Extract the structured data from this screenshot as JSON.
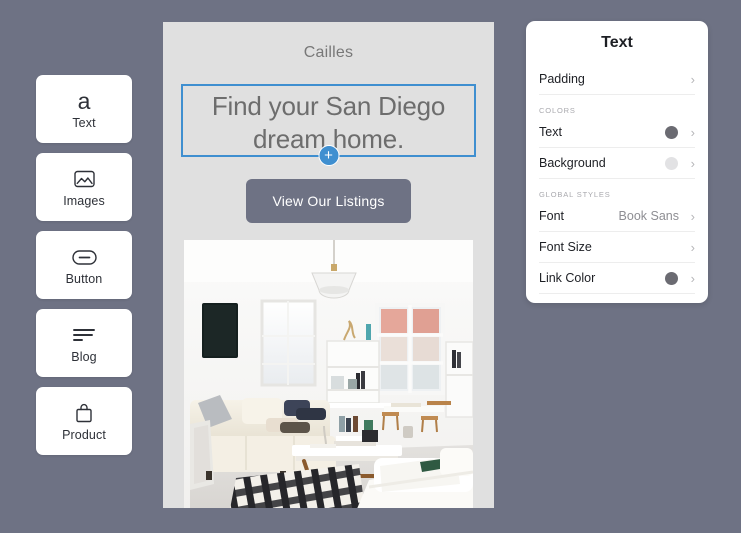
{
  "theme": {
    "page_background": "#6e7284",
    "canvas_background": "#e0e0e0",
    "selection_blue": "#3f8fd0",
    "panel_background": "#ffffff"
  },
  "sidebar": {
    "items": [
      {
        "label": "Text",
        "icon": "letter-a-icon"
      },
      {
        "label": "Images",
        "icon": "image-icon"
      },
      {
        "label": "Button",
        "icon": "button-icon"
      },
      {
        "label": "Blog",
        "icon": "text-lines-icon"
      },
      {
        "label": "Product",
        "icon": "shopping-bag-icon"
      }
    ]
  },
  "canvas": {
    "site_title": "Cailles",
    "hero_heading": "Find your San Diego dream home.",
    "add_block_label": "+",
    "cta_label": "View Our Listings",
    "photo_alt": "bright living room with white sofas, plaid blanket and wooden coffee table"
  },
  "panel": {
    "title": "Text",
    "rows_top": [
      {
        "label": "Padding",
        "value": "",
        "chevron": "›"
      }
    ],
    "colors_heading": "COLORS",
    "rows_colors": [
      {
        "label": "Text",
        "value": "",
        "swatch": "#6b6b72",
        "chevron": "›"
      },
      {
        "label": "Background",
        "value": "",
        "swatch": "#e2e2e4",
        "chevron": "›"
      }
    ],
    "global_heading": "GLOBAL STYLES",
    "rows_global": [
      {
        "label": "Font",
        "value": "Book Sans",
        "swatch": "",
        "chevron": "›"
      },
      {
        "label": "Font Size",
        "value": "",
        "swatch": "",
        "chevron": "›"
      },
      {
        "label": "Link Color",
        "value": "",
        "swatch": "#6b6b72",
        "chevron": "›"
      }
    ]
  }
}
